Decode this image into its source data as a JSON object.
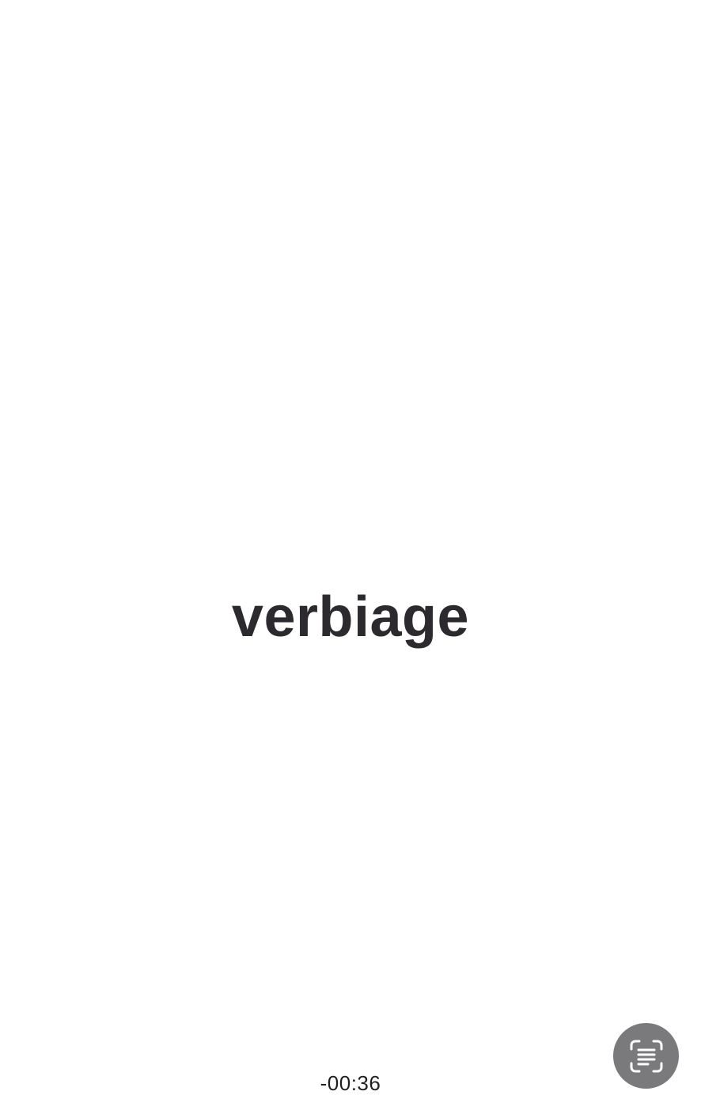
{
  "main": {
    "word": "verbiage"
  },
  "footer": {
    "timer": "-00:36"
  },
  "actions": {
    "live_text_button": {
      "icon": "live-text-scan-icon"
    }
  },
  "colors": {
    "background": "#ffffff",
    "word_text": "#2c2a2e",
    "button_background": "#7a7a7c",
    "icon_stroke": "#ffffff"
  }
}
